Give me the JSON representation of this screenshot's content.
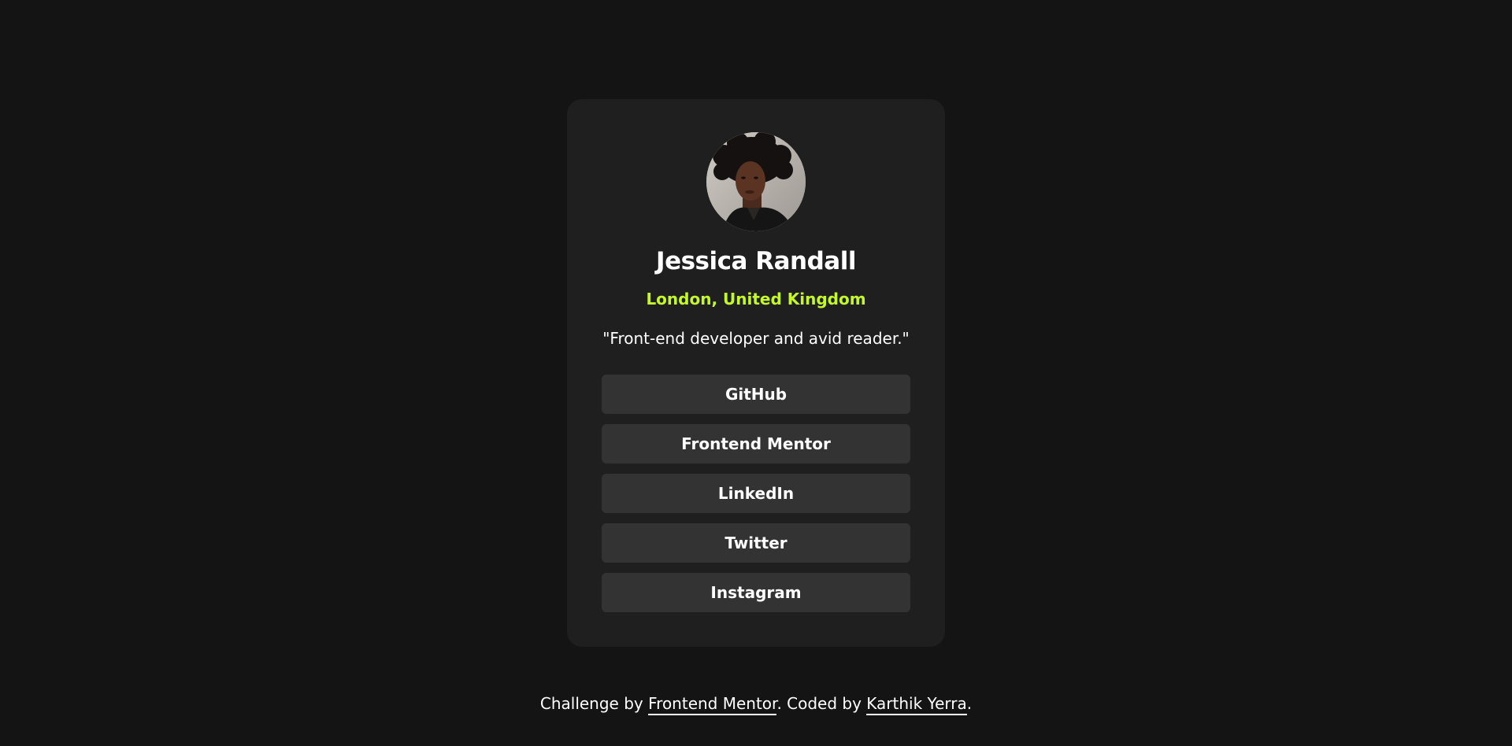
{
  "colors": {
    "background": "#141414",
    "card": "#1f1f1f",
    "button": "#333333",
    "accent": "#c4f82a",
    "text": "#ffffff"
  },
  "profile": {
    "avatar_icon": "avatar-photo",
    "name": "Jessica Randall",
    "location": "London, United Kingdom",
    "bio": "\"Front-end developer and avid reader.\""
  },
  "links": [
    {
      "label": "GitHub"
    },
    {
      "label": "Frontend Mentor"
    },
    {
      "label": "LinkedIn"
    },
    {
      "label": "Twitter"
    },
    {
      "label": "Instagram"
    }
  ],
  "footer": {
    "prefix": "Challenge by ",
    "challenge_link": "Frontend Mentor",
    "middle": ". Coded by ",
    "author_link": "Karthik Yerra",
    "suffix": "."
  }
}
